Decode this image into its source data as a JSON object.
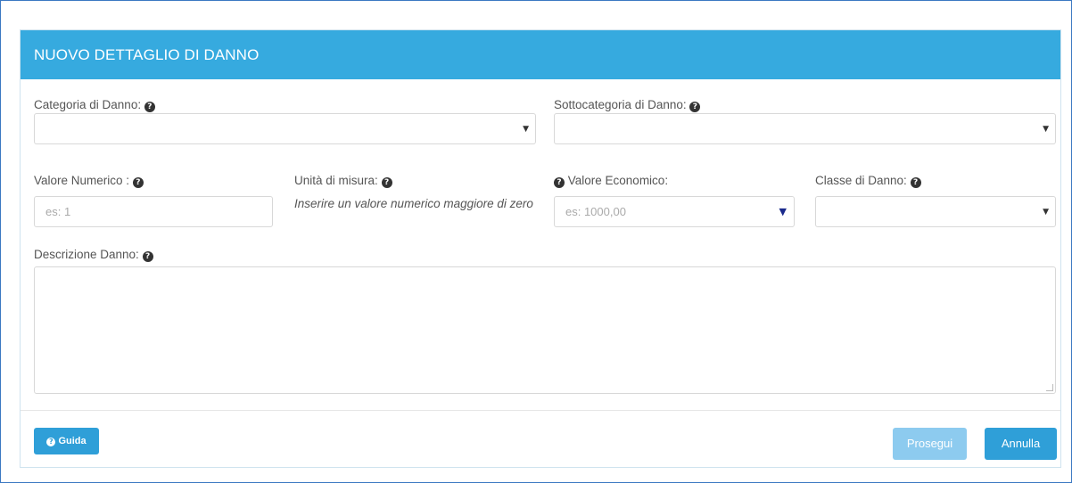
{
  "panel": {
    "title": "NUOVO DETTAGLIO DI DANNO"
  },
  "fields": {
    "categoria": {
      "label": "Categoria di Danno:",
      "value": ""
    },
    "sottocategoria": {
      "label": "Sottocategoria di Danno:",
      "value": ""
    },
    "valore_numerico": {
      "label": "Valore Numerico :",
      "placeholder": "es: 1"
    },
    "unita_misura": {
      "label": "Unità di misura:",
      "hint": "Inserire un valore numerico maggiore di zero"
    },
    "valore_economico": {
      "label": "Valore Economico:",
      "placeholder": "es: 1000,00"
    },
    "classe": {
      "label": "Classe di Danno:",
      "value": ""
    },
    "descrizione": {
      "label": "Descrizione Danno:",
      "value": ""
    }
  },
  "buttons": {
    "guida": "Guida",
    "prosegui": "Prosegui",
    "annulla": "Annulla"
  },
  "icons": {
    "help": "?",
    "caret": "▼",
    "caret_color_economico": "#1a2a8c"
  },
  "colors": {
    "header": "#36aadf",
    "primary_button": "#2f9fd8",
    "disabled_button": "#8dcbef",
    "frame_border": "#3b78c2"
  }
}
